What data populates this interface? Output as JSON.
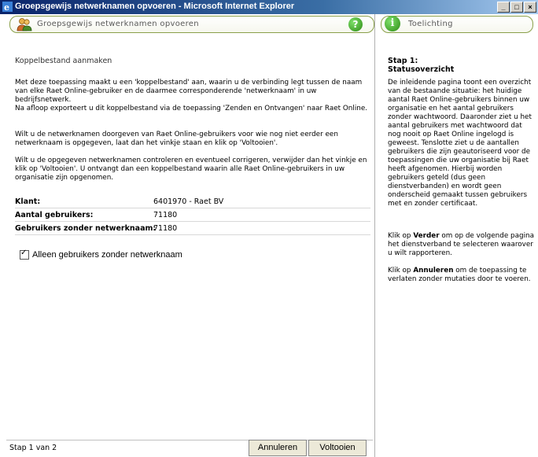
{
  "window": {
    "title": "Groepsgewijs netwerknamen opvoeren - Microsoft Internet Explorer",
    "controls": [
      "_",
      "□",
      "×"
    ]
  },
  "main": {
    "header_title": "Groepsgewijs netwerknamen opvoeren",
    "section_title": "Koppelbestand aanmaken",
    "paragraphs": [
      "Met deze toepassing maakt u een 'koppelbestand' aan, waarin u de verbinding legt tussen de naam van elke Raet Online-gebruiker en de daarmee corresponderende 'netwerknaam' in uw bedrijfsnetwerk.",
      "Na afloop exporteert u dit koppelbestand via de toepassing 'Zenden en Ontvangen' naar Raet Online.",
      "Wilt u de netwerknamen doorgeven van Raet Online-gebruikers voor wie nog niet eerder een netwerknaam is opgegeven, laat dan het vinkje staan en klik op 'Voltooien'.",
      "Wilt u de opgegeven netwerknamen controleren en eventueel corrigeren, verwijder dan het vinkje en klik op 'Voltooien'. U ontvangt dan een koppelbestand waarin alle Raet Online-gebruikers in uw organisatie zijn opgenomen."
    ],
    "info": [
      {
        "label": "Klant:",
        "value": "6401970 - Raet BV"
      },
      {
        "label": "Aantal gebruikers:",
        "value": "71180"
      },
      {
        "label": "Gebruikers zonder netwerknaam:",
        "value": "71180"
      }
    ],
    "checkbox": {
      "label": "Alleen gebruikers zonder netwerknaam",
      "checked": true
    }
  },
  "footer": {
    "step": "Stap 1 van 2",
    "cancel_label": "Annuleren",
    "finish_label": "Voltooien"
  },
  "side": {
    "header_title": "Toelichting",
    "step_title_1": "Stap 1:",
    "step_title_2": "Statusoverzicht",
    "para1": "De inleidende pagina toont een overzicht van de bestaande situatie: het huidige aantal Raet Online-gebruikers binnen uw organisatie en het aantal gebruikers zonder wachtwoord. Daaronder ziet u het aantal gebruikers met wachtwoord dat nog nooit op Raet Online ingelogd is geweest. Tenslotte ziet u de aantallen gebruikers die zijn geautoriseerd voor de toepassingen die uw organisatie bij Raet heeft afgenomen. Hierbij worden gebruikers geteld (dus geen dienstverbanden) en wordt geen onderscheid gemaakt tussen gebruikers met en zonder certificaat.",
    "para2_pre": "Klik op ",
    "para2_bold": "Verder",
    "para2_post": " om op de volgende pagina het dienstverband te selecteren waarover u wilt rapporteren.",
    "para3_pre": "Klik op ",
    "para3_bold": "Annuleren",
    "para3_post": " om de toepassing te verlaten zonder mutaties door te voeren."
  }
}
